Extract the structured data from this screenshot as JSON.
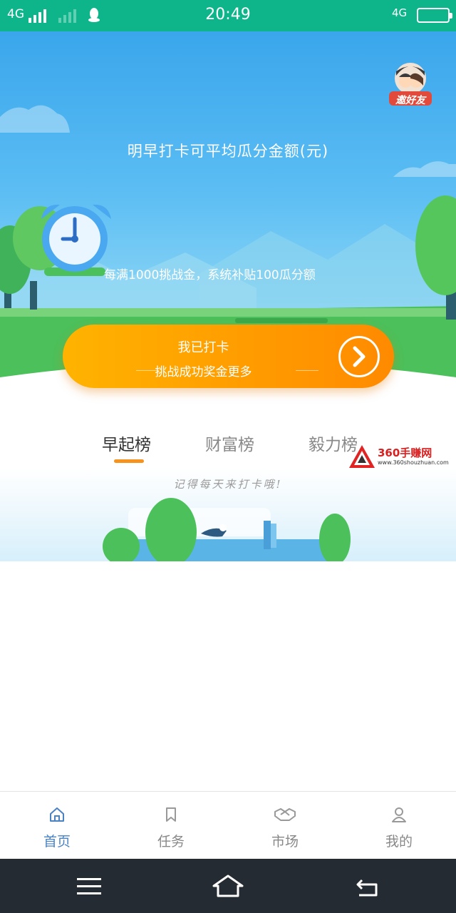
{
  "status_bar": {
    "network_left": "4G",
    "network_right": "4G",
    "time": "20:49",
    "icons": [
      "signal-icon",
      "signal-weak-icon",
      "qq-icon",
      "battery-icon"
    ]
  },
  "hero": {
    "invite_label": "邀好友",
    "title": "明早打卡可平均瓜分金额(元)",
    "subtitle": "每满1000挑战金，系统补贴100瓜分额",
    "icons": [
      "alarm-clock-icon"
    ]
  },
  "checkin_button": {
    "label": "我已打卡",
    "sublabel": "挑战成功奖金更多",
    "icon": "chevron-right-icon"
  },
  "leaderboard": {
    "tabs": [
      {
        "label": "早起榜",
        "active": true
      },
      {
        "label": "财富榜",
        "active": false
      },
      {
        "label": "毅力榜",
        "active": false
      }
    ],
    "empty_text": "记得每天来打卡哦!"
  },
  "watermark": {
    "text": "360手赚网",
    "url": "www.360shouzhuan.com"
  },
  "bottom_nav": {
    "items": [
      {
        "label": "首页",
        "icon": "home-icon",
        "active": true
      },
      {
        "label": "任务",
        "icon": "bookmark-icon",
        "active": false
      },
      {
        "label": "市场",
        "icon": "handshake-icon",
        "active": false
      },
      {
        "label": "我的",
        "icon": "user-icon",
        "active": false
      }
    ]
  },
  "system_nav": {
    "icons": [
      "menu-icon",
      "home-outline-icon",
      "back-icon"
    ]
  },
  "colors": {
    "status_bar": "#0fb58a",
    "accent_orange": "#ff9800",
    "tab_underline": "#f6921e",
    "nav_active": "#4a82c4"
  }
}
